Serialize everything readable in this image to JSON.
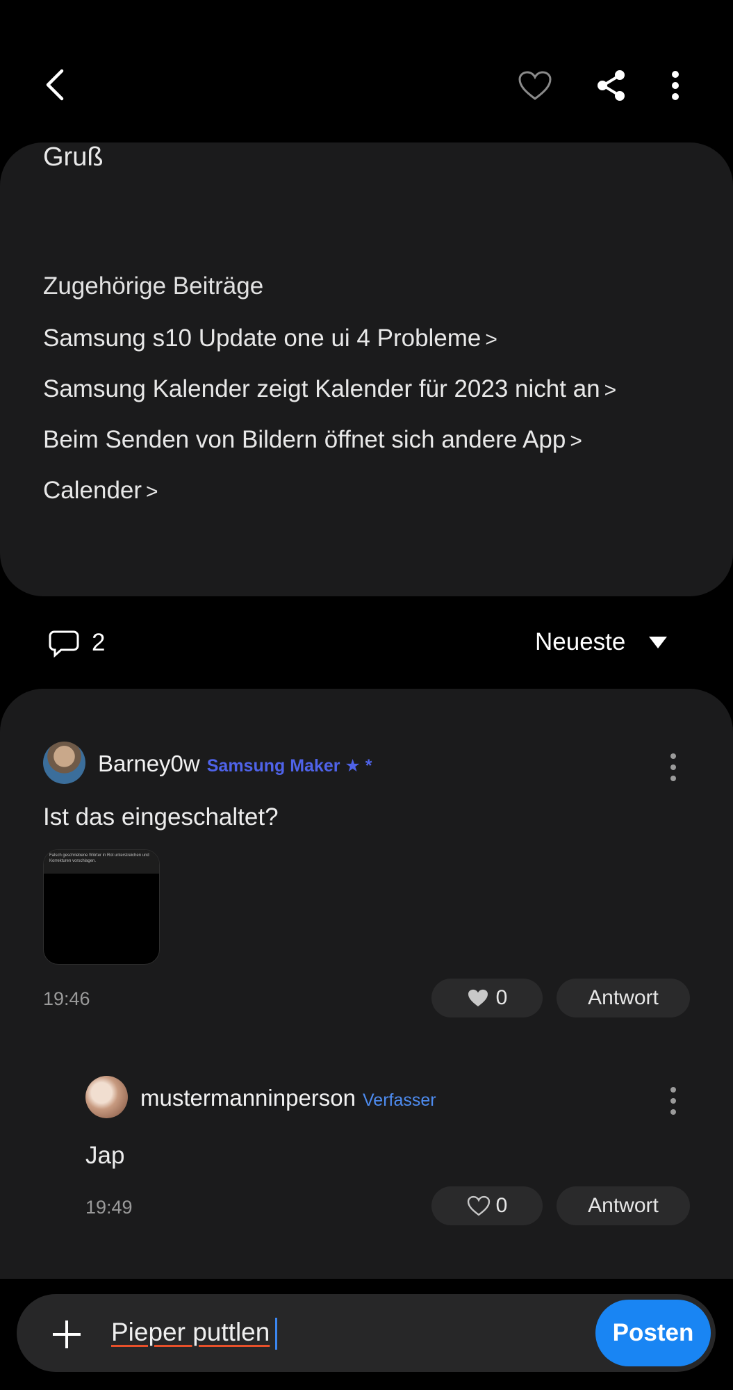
{
  "header": {
    "back_icon": "chevron-left-icon",
    "like_icon": "heart-outline-icon",
    "share_icon": "share-icon",
    "more_icon": "kebab-icon"
  },
  "post": {
    "closing": "Gruß",
    "related_title": "Zugehörige Beiträge",
    "related_chevron": ">",
    "related": [
      "Samsung s10 Update one ui 4 Probleme",
      "Samsung Kalender zeigt Kalender für 2023 nicht an",
      "Beim Senden von Bildern öffnet sich andere App",
      "Calender"
    ]
  },
  "comments_bar": {
    "count": "2",
    "sort_label": "Neueste"
  },
  "comments": [
    {
      "user": "Barney0w",
      "badge": "Samsung Maker ★ *",
      "text": "Ist das eingeschaltet?",
      "attachment_caption": "Falsch geschriebene Wörter in Rot unterstreichen und Korrekturen vorschlagen.",
      "time": "19:46",
      "likes": "0",
      "reply_label": "Antwort"
    },
    {
      "user": "mustermanninperson",
      "badge": "Verfasser",
      "text": "Jap",
      "time": "19:49",
      "likes": "0",
      "reply_label": "Antwort"
    }
  ],
  "composer": {
    "value": "Pieper puttlen",
    "post_label": "Posten"
  },
  "colors": {
    "background": "#000000",
    "card": "#1b1b1c",
    "accent": "#1985f3",
    "maker_badge": "#4f63e9",
    "author_badge": "#4e8cf0"
  }
}
